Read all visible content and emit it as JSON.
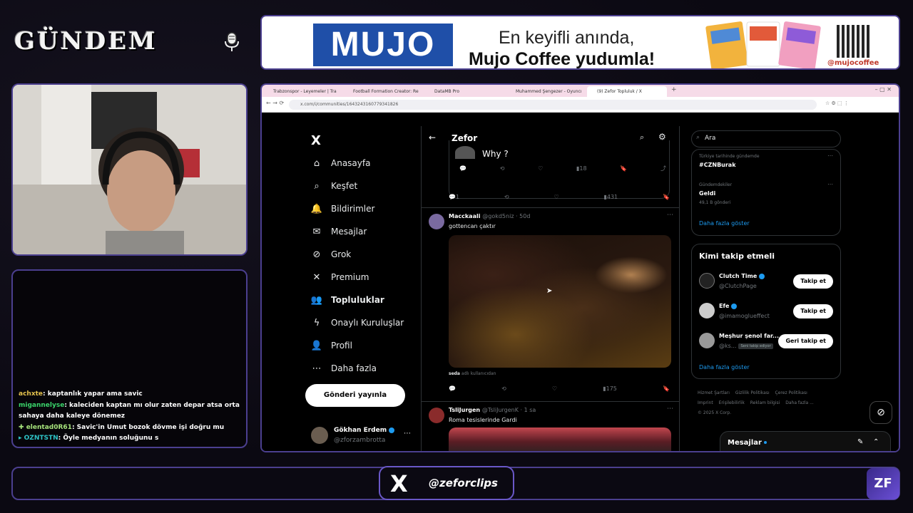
{
  "overlay": {
    "logo_text": "GÜNDEM",
    "banner": {
      "brand": "MUJO",
      "line1": "En keyifli anında,",
      "line2": "Mujo Coffee yudumla!",
      "social": "@mujocoffee"
    },
    "chat": [
      {
        "user": "achxte",
        "text": ": kaptanlık yapar ama savic"
      },
      {
        "user": "migannelyse",
        "text": ": kaleciden kaptan mı olur zaten depar atsa orta sahaya daha kaleye dönemez"
      },
      {
        "user": "elentad0R61",
        "text": ": Savic'in Umut bozok dövme işi doğru mu"
      },
      {
        "user": "OZNTSTN",
        "text": ": Öyle medyanın soluğunu s"
      }
    ],
    "x_handle": "@zeforclips",
    "x_logo": "X",
    "brand_mark": "ZF"
  },
  "browser": {
    "tabs": [
      {
        "label": "Trabzonspor - Leyemeler | Tra"
      },
      {
        "label": "Football Formation Creator: Re"
      },
      {
        "label": "DataMB Pro"
      },
      {
        "label": "Muhammed Şengezer - Oyuncı"
      },
      {
        "label": "(9) Zefor Topluluk / X"
      }
    ],
    "url": "x.com/i/communities/1643243160779341826"
  },
  "x": {
    "logo": "X",
    "nav": [
      {
        "label": "Anasayfa",
        "icon": "home-icon",
        "glyph": "⌂"
      },
      {
        "label": "Keşfet",
        "icon": "search-icon",
        "glyph": "⌕"
      },
      {
        "label": "Bildirimler",
        "icon": "bell-icon",
        "glyph": "🔔"
      },
      {
        "label": "Mesajlar",
        "icon": "mail-icon",
        "glyph": "✉"
      },
      {
        "label": "Grok",
        "icon": "grok-icon",
        "glyph": "⊘"
      },
      {
        "label": "Premium",
        "icon": "x-premium-icon",
        "glyph": "✕"
      },
      {
        "label": "Topluluklar",
        "icon": "communities-icon",
        "glyph": "👥"
      },
      {
        "label": "Onaylı Kuruluşlar",
        "icon": "lightning-icon",
        "glyph": "ϟ"
      },
      {
        "label": "Profil",
        "icon": "person-icon",
        "glyph": "👤"
      },
      {
        "label": "Daha fazla",
        "icon": "more-circle-icon",
        "glyph": "⋯"
      }
    ],
    "post_button": "Gönderi yayınla",
    "me": {
      "name": "Gökhan Erdem",
      "handle": "@zforzambrotta"
    },
    "community_title": "Zefor",
    "quote_text": "Why ?",
    "quote_views": "18",
    "post0_actions": {
      "replies": "1",
      "views": "431"
    },
    "post1": {
      "name": "Macckaali",
      "handle": "@gokd5niz · 50d",
      "text": "gottencan çaktır",
      "caption_user": "seda",
      "caption_text": "adlı kullanıcıdan",
      "views": "175"
    },
    "post2": {
      "name": "TsliJurgen",
      "handle": "@TsliJurgenK · 1 sa",
      "text": "Roma tesislerinde Gardi"
    },
    "search_placeholder": "Ara",
    "trends": [
      {
        "category": "Türkiye tarihinde gündemde",
        "name": "#CZNBurak",
        "count": ""
      },
      {
        "category": "Gündemdekiler",
        "name": "Geldi",
        "count": "49,1 B gönderi"
      }
    ],
    "show_more": "Daha fazla göster",
    "who_to_follow": {
      "title": "Kimi takip etmeli",
      "items": [
        {
          "name": "Clutch Time",
          "handle": "@ClutchPage",
          "button": "Takip et",
          "badge": ""
        },
        {
          "name": "Efe",
          "handle": "@imamoglueffect",
          "button": "Takip et",
          "badge": ""
        },
        {
          "name": "Meşhur şenol far...",
          "handle": "@ks...",
          "button": "Geri takip et",
          "badge": "Seni takip ediyor"
        }
      ],
      "show_more": "Daha fazla göster"
    },
    "footer": [
      "Hizmet Şartları",
      "Gizlilik Politikası",
      "Çerez Politikası",
      "Imprint",
      "Erişilebilirlik",
      "Reklam bilgisi",
      "Daha fazla ...",
      "© 2025 X Corp."
    ],
    "messages_bar": "Mesajlar"
  },
  "colors": {
    "accent": "#1d9bf0",
    "frame": "#4b3f8f",
    "bg": "#000000"
  }
}
